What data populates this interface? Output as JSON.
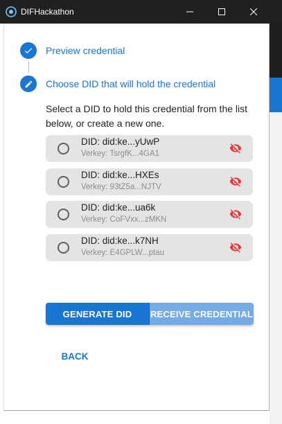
{
  "window": {
    "title": "DIFHackathon"
  },
  "stepper": {
    "steps": [
      {
        "label": "Preview credential",
        "state": "completed",
        "icon": "check-icon"
      },
      {
        "label": "Choose DID that will hold the credential",
        "state": "active",
        "icon": "edit-pencil-icon"
      }
    ]
  },
  "instructions": "Select a DID to hold this credential from the list below, or create a new one.",
  "dids": [
    {
      "name": "DID: did:ke...yUwP",
      "verkey": "Verkey: TsrgfK...4GA1",
      "selected": false,
      "status_icon": "visibility-off-icon"
    },
    {
      "name": "DID: did:ke...HXEs",
      "verkey": "Verkey: 93tZ5a...NJTV",
      "selected": false,
      "status_icon": "visibility-off-icon"
    },
    {
      "name": "DID: did:ke...ua6k",
      "verkey": "Verkey: CoFVxx...zMKN",
      "selected": false,
      "status_icon": "visibility-off-icon"
    },
    {
      "name": "DID: did:ke...k7NH",
      "verkey": "Verkey: E4GPLW...ptau",
      "selected": false,
      "status_icon": "visibility-off-icon"
    }
  ],
  "actions": {
    "generate_label": "GENERATE DID",
    "receive_label": "RECEIVE CREDENTIAL",
    "back_label": "BACK"
  },
  "colors": {
    "primary": "#1976d2",
    "primary_disabled": "#74abe5",
    "warning_red": "#e53935",
    "titlebar": "#202020",
    "list_item_bg": "#e4e4e4"
  }
}
